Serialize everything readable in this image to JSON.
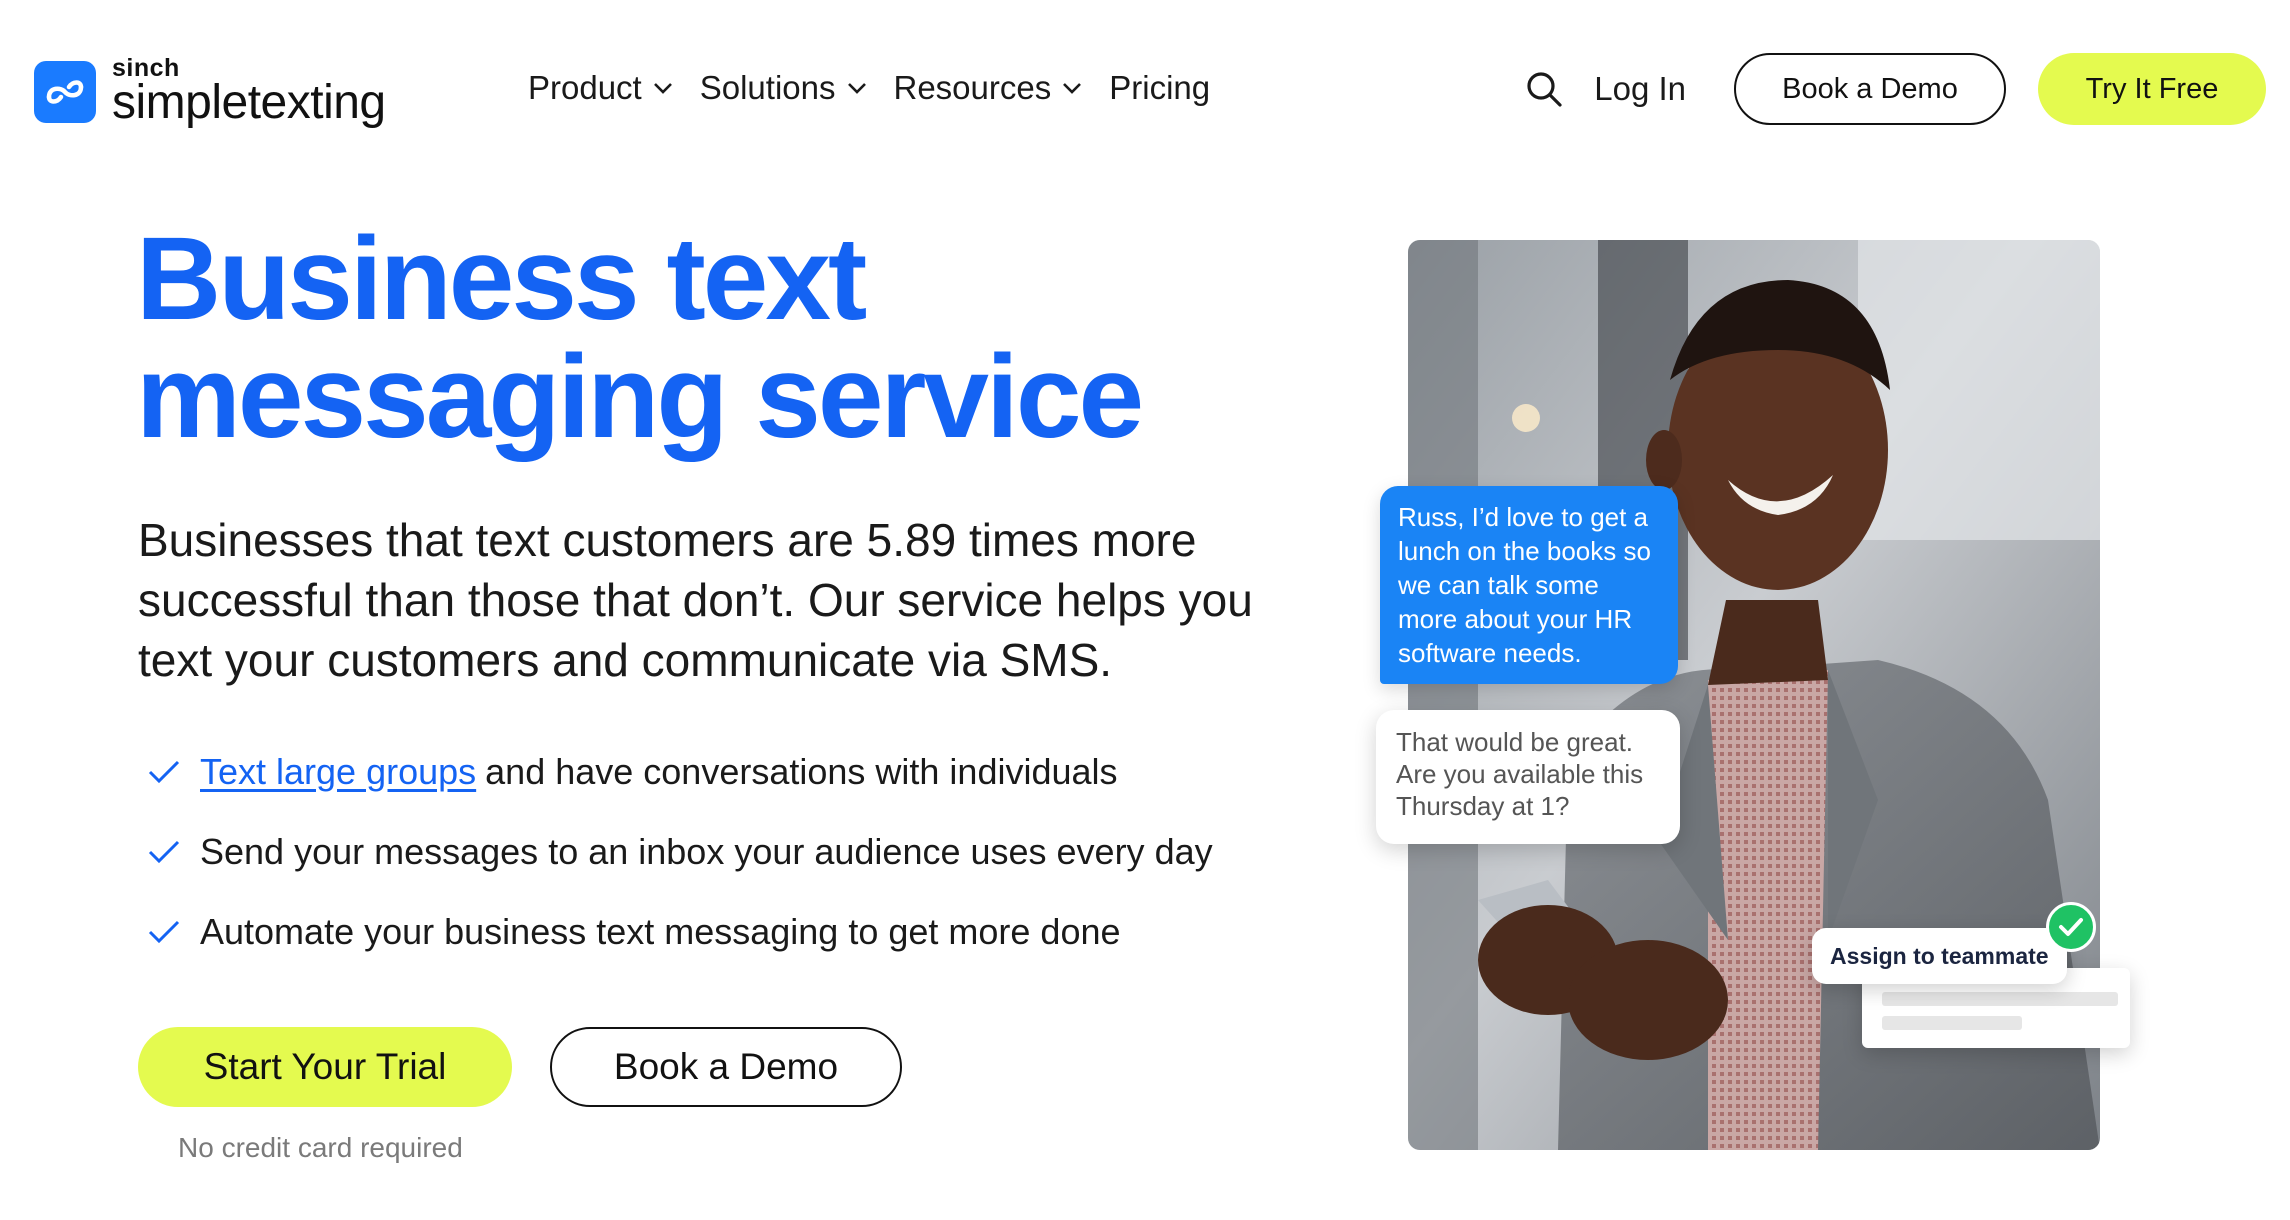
{
  "brand": {
    "company": "sinch",
    "product": "simpletexting",
    "accent": "#1463f3",
    "cta_color": "#e4fa4f"
  },
  "nav": {
    "items": [
      {
        "label": "Product",
        "has_dropdown": true
      },
      {
        "label": "Solutions",
        "has_dropdown": true
      },
      {
        "label": "Resources",
        "has_dropdown": true
      },
      {
        "label": "Pricing",
        "has_dropdown": false
      }
    ],
    "search_icon": "search-icon",
    "login_label": "Log In",
    "demo_label": "Book a Demo",
    "trial_label": "Try It Free"
  },
  "hero": {
    "title": "Business text messaging service",
    "subtitle": "Businesses that text customers are 5.89 times more successful than those that don’t. Our service helps you text your customers and communicate via SMS.",
    "features": [
      {
        "link": "Text large groups",
        "text": "and have conversations with individuals"
      },
      {
        "link": "",
        "text": "Send your messages to an inbox your audience uses every day"
      },
      {
        "link": "",
        "text": "Automate your business text messaging to get more done"
      }
    ],
    "primary_cta": "Start Your Trial",
    "secondary_cta": "Book a Demo",
    "note": "No credit card required"
  },
  "illustration": {
    "message_out": "Russ, I’d love to get a lunch on the books so we can talk some more about your HR software needs.",
    "message_in": "That would be great. Are you available this Thursday at 1?",
    "assign_label": "Assign to teammate"
  }
}
